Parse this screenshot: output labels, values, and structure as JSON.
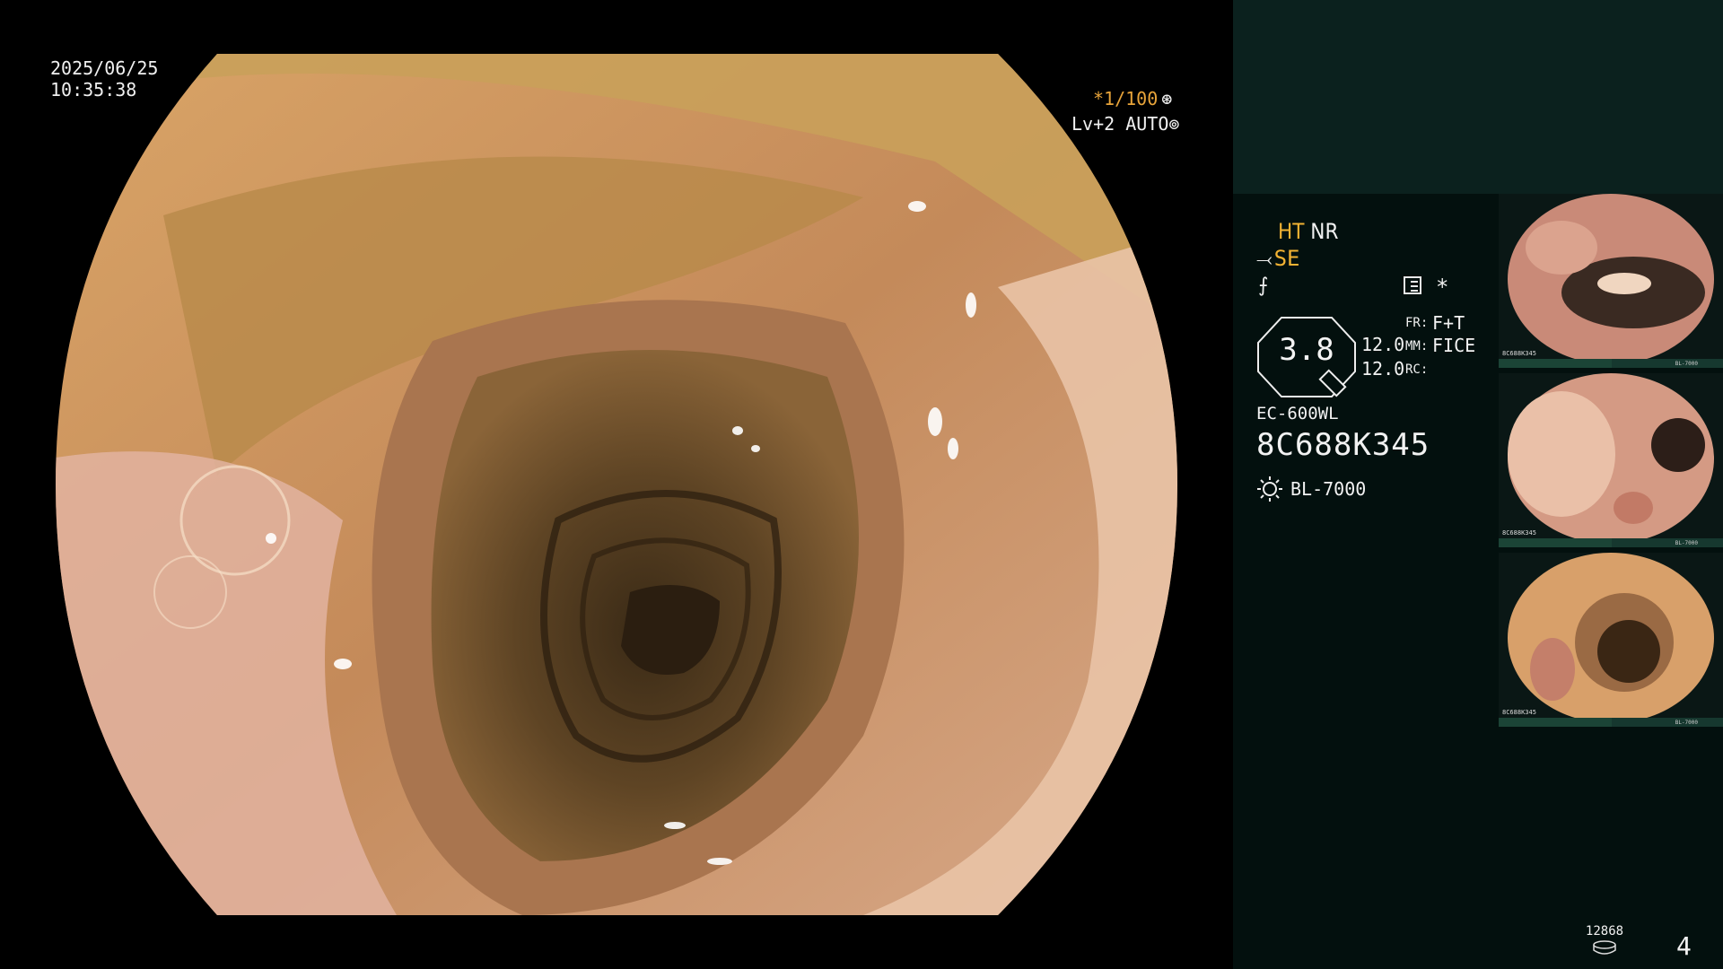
{
  "viewer": {
    "date": "2025/06/25",
    "time": "10:35:38",
    "shutter": "*1/100",
    "shutter_icon": "aperture-icon",
    "level": "Lv+2 AUTO",
    "level_icon": "iris-icon"
  },
  "panel": {
    "ht": "HT",
    "nr": "NR",
    "se": "SE",
    "zoom": "3.8",
    "v1": "12.0",
    "v2": "12.0",
    "fr_label": "FR:",
    "fr_value": "F+T",
    "mm_label": "MM:",
    "mm_value": "FICE",
    "rc_label": "RC:",
    "star": "*",
    "model": "EC-600WL",
    "serial": "8C688K345",
    "light_source": "BL-7000",
    "image_count": "12868",
    "page_number": "4"
  },
  "thumbnails": [
    {
      "caption": "8C688K345",
      "light": "BL-7000"
    },
    {
      "caption": "8C688K345",
      "light": "BL-7000"
    },
    {
      "caption": "8C688K345",
      "light": "BL-7000"
    }
  ],
  "colors": {
    "accent": "#f2b233",
    "panel_bg": "#03100e",
    "panel_top_bg": "#0b211e"
  }
}
